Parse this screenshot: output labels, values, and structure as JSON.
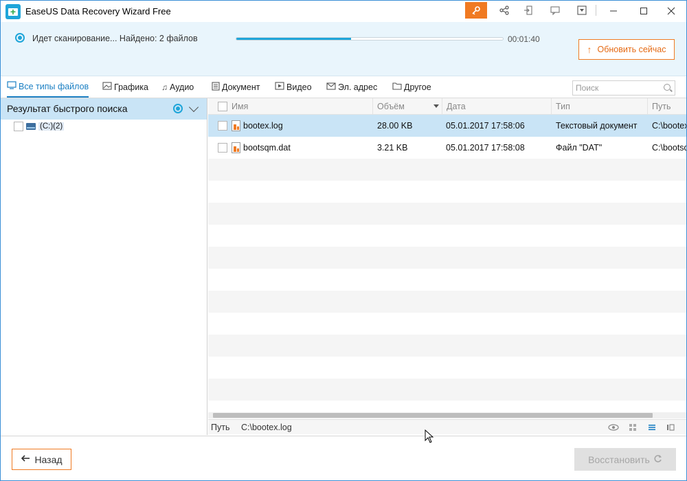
{
  "window": {
    "title": "EaseUS Data Recovery Wizard Free"
  },
  "scan": {
    "status": "Идет сканирование... Найдено: 2 файлов",
    "progress_percent": 43,
    "elapsed": "00:01:40",
    "update_label": "Обновить сейчас"
  },
  "filters": [
    {
      "label": "Все типы файлов",
      "icon": "monitor-icon",
      "active": true
    },
    {
      "label": "Графика",
      "icon": "image-icon",
      "active": false
    },
    {
      "label": "Аудио",
      "icon": "music-icon",
      "active": false
    },
    {
      "label": "Документ",
      "icon": "document-icon",
      "active": false
    },
    {
      "label": "Видео",
      "icon": "video-icon",
      "active": false
    },
    {
      "label": "Эл. адрес",
      "icon": "mail-icon",
      "active": false
    },
    {
      "label": "Другое",
      "icon": "folder-icon",
      "active": false
    }
  ],
  "search": {
    "placeholder": "Поиск"
  },
  "left_panel": {
    "title": "Результат быстрого поиска",
    "tree": [
      {
        "label": "(C:)(2)"
      }
    ]
  },
  "table": {
    "columns": [
      "Имя",
      "Объём",
      "Дата",
      "Тип",
      "Путь"
    ],
    "rows": [
      {
        "name": "bootex.log",
        "size": "28.00 KB",
        "date": "05.01.2017 17:58:06",
        "type": "Текстовый документ",
        "path": "C:\\bootex.log",
        "selected": true
      },
      {
        "name": "bootsqm.dat",
        "size": "3.21 KB",
        "date": "05.01.2017 17:58:08",
        "type": "Файл \"DAT\"",
        "path": "C:\\bootsqm.dat",
        "selected": false
      }
    ]
  },
  "pathbar": {
    "label": "Путь",
    "value": "C:\\bootex.log"
  },
  "footer": {
    "back_label": "Назад",
    "restore_label": "Восстановить"
  },
  "colors": {
    "accent": "#1ea5d9",
    "orange": "#f07a22",
    "selected_row": "#c9e4f6",
    "header_bg": "#e9f5fc"
  }
}
